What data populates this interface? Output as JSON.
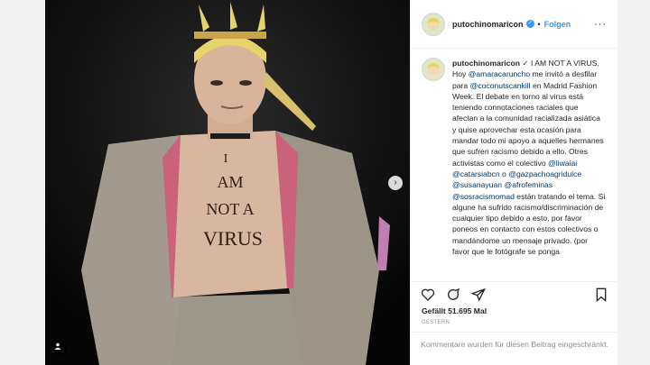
{
  "post": {
    "username": "putochinomaricon",
    "follow_label": "Folgen",
    "more_icon": "more-options-icon",
    "caption_parts": [
      {
        "t": "u",
        "v": "putochinomaricon"
      },
      {
        "t": "x",
        "v": " ✓ I AM NOT A VIRUS. Hoy "
      },
      {
        "t": "m",
        "v": "@amaracaruncho"
      },
      {
        "t": "x",
        "v": " me invitó a desfilar para "
      },
      {
        "t": "m",
        "v": "@coconutscankill"
      },
      {
        "t": "x",
        "v": " en Madrid Fashion Week. El debate en torno al virus está teniendo connotaciones raciales que afectan a la comunidad racializada asiática y quise aprovechar esta ocasión para mandar todo mi apoyo a aquelles hermanes que sufren racismo debido a ello. Otres activistas como el colectivo "
      },
      {
        "t": "m",
        "v": "@liwaiai"
      },
      {
        "t": "x",
        "v": " "
      },
      {
        "t": "m",
        "v": "@catarsiabcn"
      },
      {
        "t": "x",
        "v": " o "
      },
      {
        "t": "m",
        "v": "@gazpachoagridulce"
      },
      {
        "t": "x",
        "v": " "
      },
      {
        "t": "m",
        "v": "@susanayuan"
      },
      {
        "t": "x",
        "v": " "
      },
      {
        "t": "m",
        "v": "@afrofeminas"
      },
      {
        "t": "x",
        "v": " "
      },
      {
        "t": "m",
        "v": "@sosracismomad"
      },
      {
        "t": "x",
        "v": " están tratando el tema. Si algune ha sufrido racismo/discriminación de cualquier tipo debido a esto, por favor poneos en contacto con estos colectivos o mandándome un mensaje privado. (por favor que le fotógrafe se ponga"
      }
    ],
    "likes": "Gefällt 51.695 Mal",
    "date": "GESTERN",
    "comments_limited": "Kommentare wurden für diesen Beitrag eingeschränkt."
  },
  "photo": {
    "body_text_lines": [
      "I",
      "AM",
      "NOT A",
      "VIRUS"
    ]
  },
  "colors": {
    "accent": "#3897f0",
    "mention": "#00376b",
    "muted": "#8e8e8e"
  },
  "icons": [
    "heart-icon",
    "comment-icon",
    "share-icon",
    "bookmark-icon",
    "next-arrow-icon",
    "user-tag-icon",
    "verified-badge-icon"
  ]
}
